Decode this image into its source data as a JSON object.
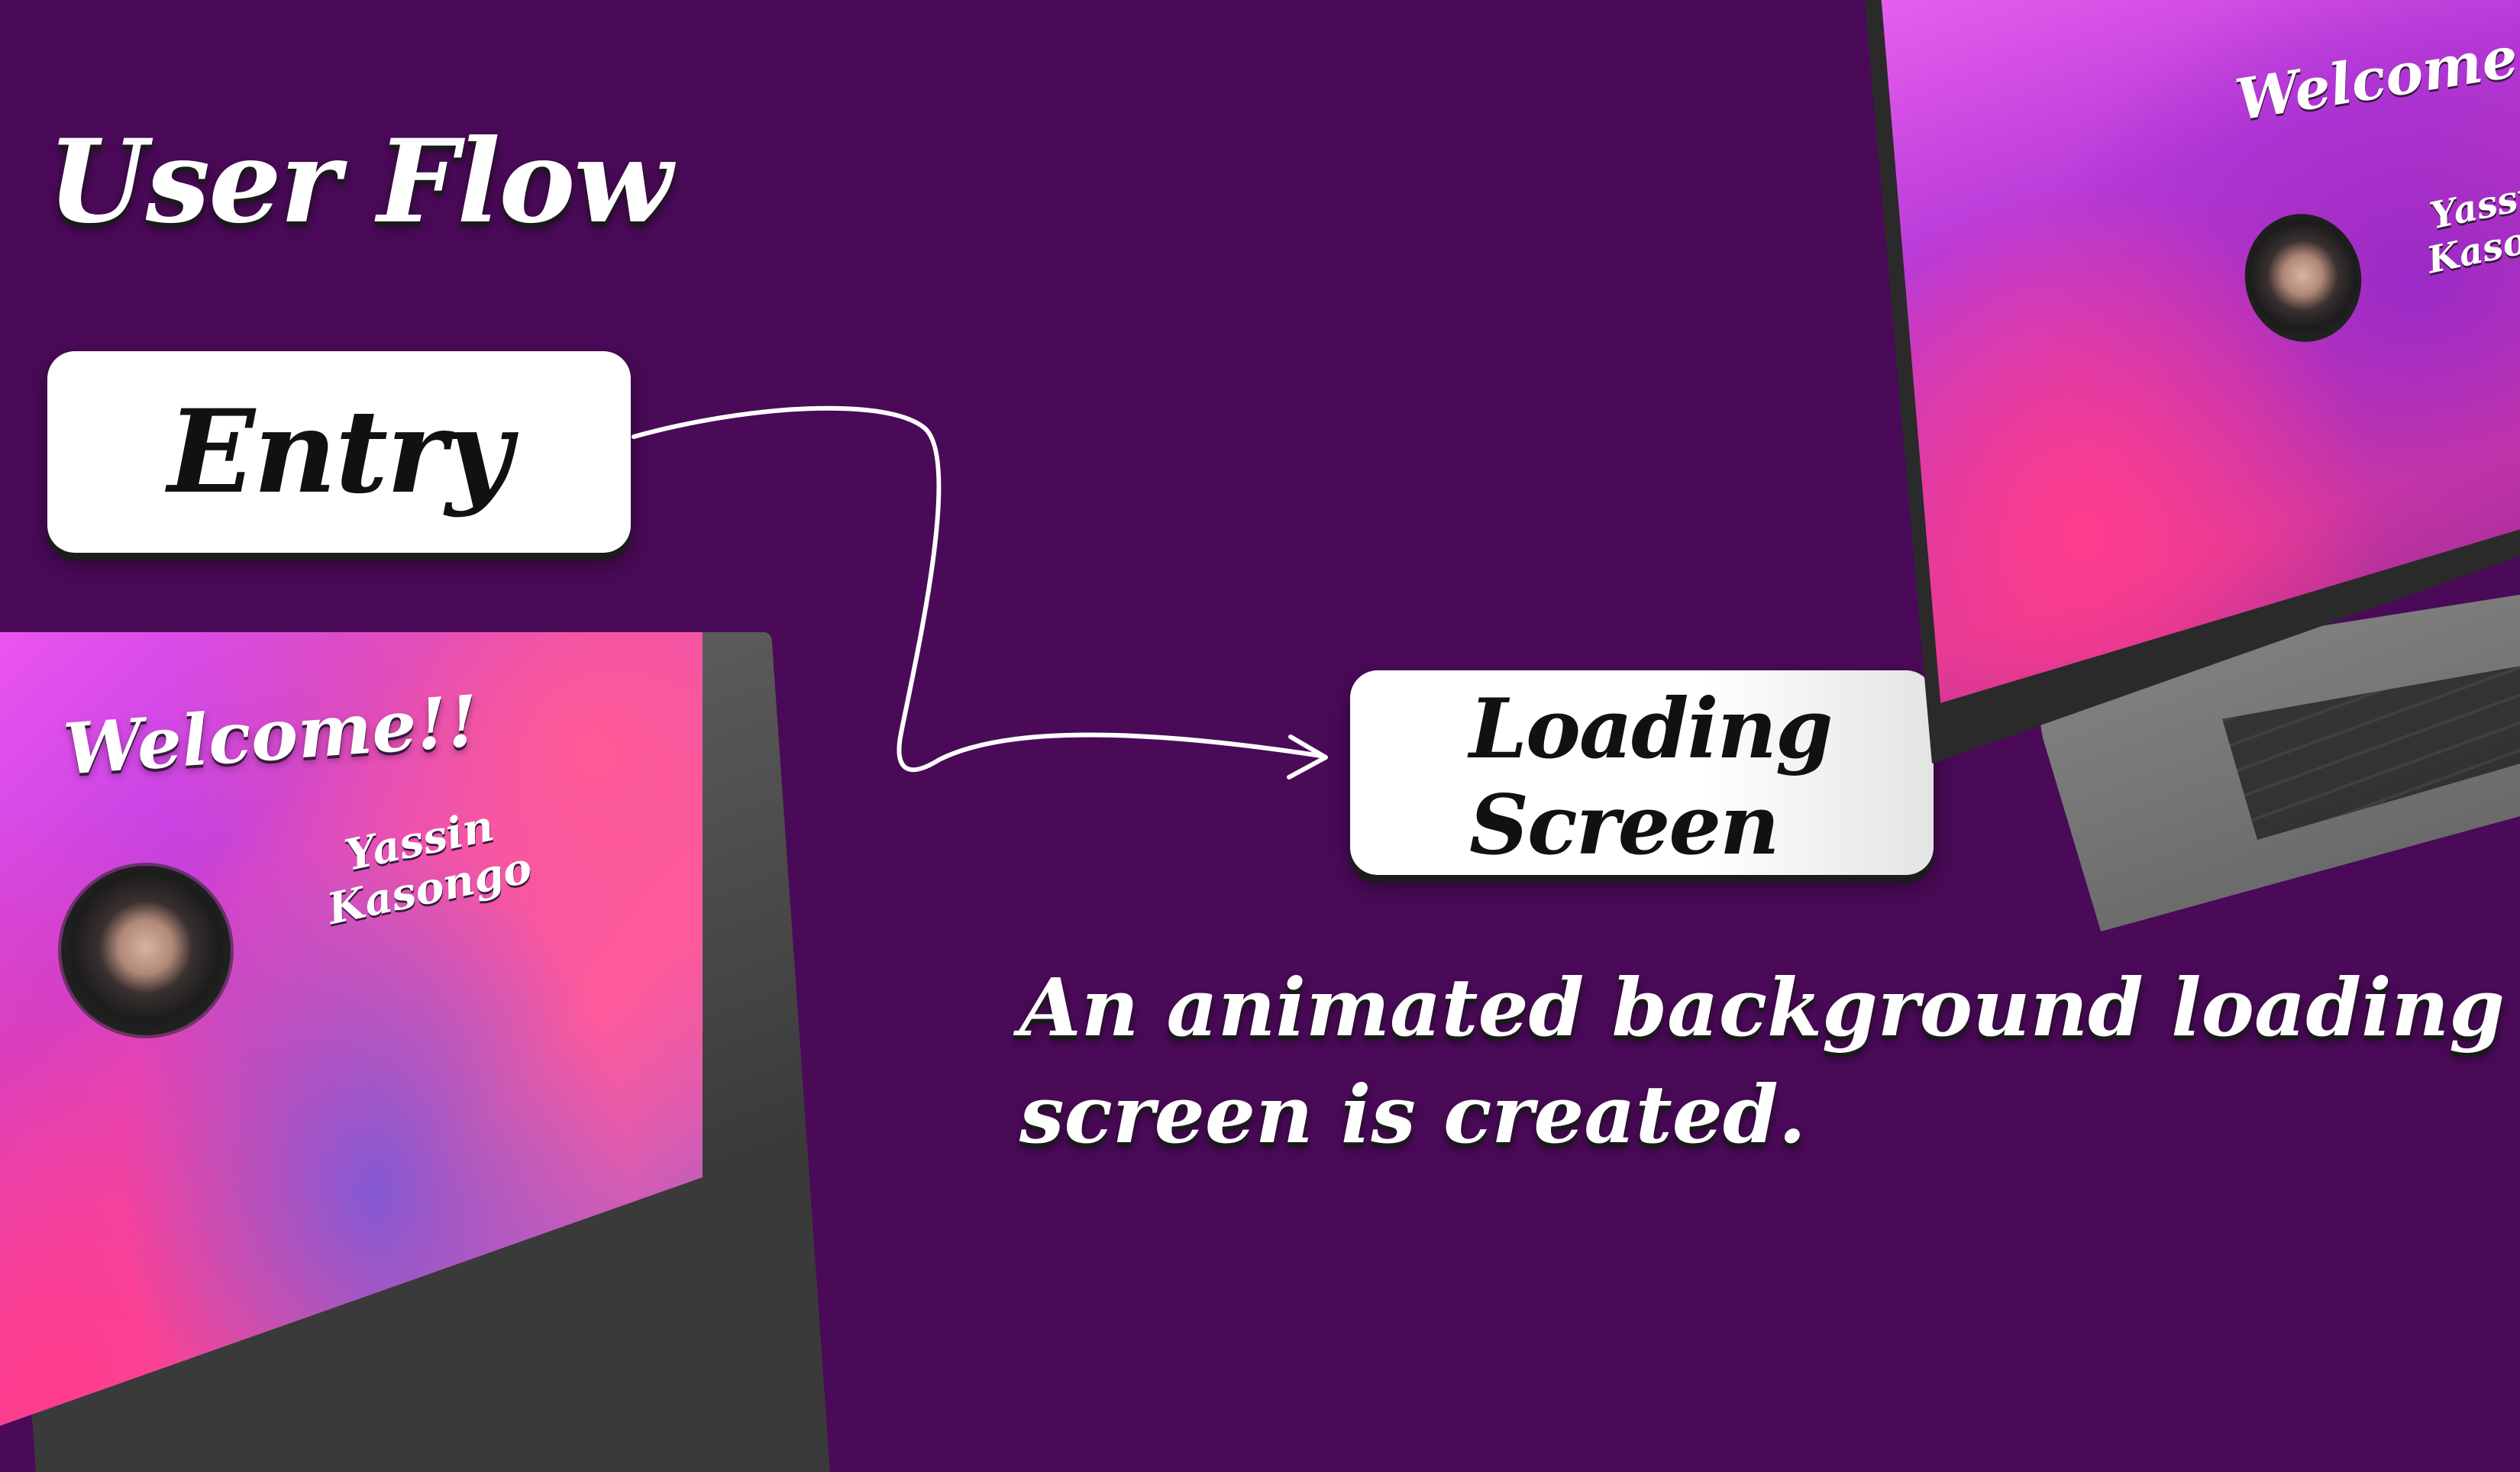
{
  "page": {
    "title": "User Flow",
    "description_line1": "An animated background  loading",
    "description_line2": "screen is created.",
    "background_color": "#4a0a58"
  },
  "flow": {
    "entry_label": "Entry",
    "loading_label_line1": "Loading",
    "loading_label_line2": "Screen",
    "connector_icon": "arrow-icon"
  },
  "left_laptop": {
    "welcome_text": "Welcome!!",
    "user_first_name": "Yassin",
    "user_last_name": "Kasongo",
    "avatar_icon": "user-avatar"
  },
  "right_laptop": {
    "welcome_text": "Welcome!!",
    "user_first_name": "Yassin",
    "user_last_name": "Kasong",
    "avatar_icon": "user-avatar"
  },
  "colors": {
    "accent_pink": "#ff5aa0",
    "accent_violet": "#c040e0",
    "box_fill": "#ffffff"
  }
}
